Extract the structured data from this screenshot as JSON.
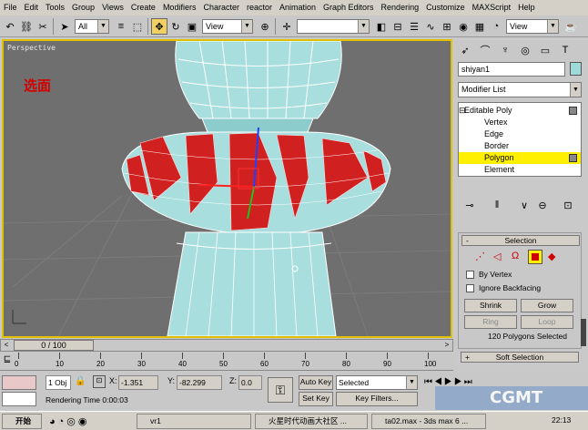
{
  "menu": [
    "File",
    "Edit",
    "Tools",
    "Group",
    "Views",
    "Create",
    "Modifiers",
    "Character",
    "reactor",
    "Animation",
    "Graph Editors",
    "Rendering",
    "Customize",
    "MAXScript",
    "Help"
  ],
  "toolbar": {
    "selection_filter": "All",
    "reference_coord": "View",
    "named_selection": "",
    "render_view": "View"
  },
  "viewport": {
    "label": "Perspective",
    "annotation": "选面"
  },
  "panel": {
    "object_name": "shiyan1",
    "object_color": "#9fd9d9",
    "modifier_list": "Modifier List",
    "stack": [
      {
        "label": "Editable Poly",
        "level": 0
      },
      {
        "label": "Vertex",
        "level": 1
      },
      {
        "label": "Edge",
        "level": 1
      },
      {
        "label": "Border",
        "level": 1
      },
      {
        "label": "Polygon",
        "level": 1
      },
      {
        "label": "Element",
        "level": 1
      }
    ],
    "selected_index": 4
  },
  "selection_rollout": {
    "minus": "-",
    "title": "Selection",
    "by_vertex": "By Vertex",
    "ignore_backfacing": "Ignore Backfacing",
    "shrink": "Shrink",
    "grow": "Grow",
    "ring": "Ring",
    "loop": "Loop",
    "status": "120 Polygons Selected",
    "plus": "+",
    "soft_selection": "Soft Selection"
  },
  "timeline": {
    "frame": "0 / 100",
    "ticks": [
      "0",
      "10",
      "20",
      "30",
      "40",
      "50",
      "60",
      "70",
      "80",
      "90",
      "100"
    ]
  },
  "status": {
    "objects": "1 Obj",
    "x_label": "X:",
    "x": "-1.351",
    "y_label": "Y:",
    "y": "-82.299",
    "z_label": "Z:",
    "z": "0.0",
    "render_time": "Rendering Time  0:00:03",
    "auto_key": "Auto Key",
    "selected": "Selected",
    "set_key": "Set Key",
    "key_filters": "Key Filters..."
  },
  "logo": "CGMT",
  "taskbar": {
    "start": "开始",
    "tasks": [
      "vr1",
      "火星时代动画大社区 ...",
      "ta02.max - 3ds max 6 ..."
    ],
    "clock": "22:13"
  },
  "colors": {
    "accent_yellow": "#ffef00",
    "viewport_bg": "#6f6f6f",
    "mesh_cyan": "#a8dede",
    "selected_red": "#d02020"
  }
}
